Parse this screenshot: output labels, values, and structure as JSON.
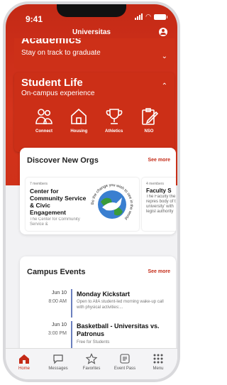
{
  "status": {
    "time": "9:41"
  },
  "header": {
    "title": "Universitas"
  },
  "academics": {
    "title": "Academics",
    "subtitle": "Stay on track to graduate"
  },
  "student_life": {
    "title": "Student Life",
    "subtitle": "On-campus experience",
    "items": [
      {
        "label": "Connect",
        "icon": "people-icon"
      },
      {
        "label": "Housing",
        "icon": "house-icon"
      },
      {
        "label": "Athletics",
        "icon": "trophy-icon"
      },
      {
        "label": "NSO",
        "icon": "clipboard-edit-icon"
      }
    ]
  },
  "orgs": {
    "title": "Discover New Orgs",
    "see_more": "See more",
    "items": [
      {
        "members": "7 members",
        "name": "Center for Community Service & Civic Engagement",
        "desc": "The Center for Community Service &"
      },
      {
        "members": "4 members",
        "name": "Faculty S",
        "desc": "The Faculty the repres body of th university' with legisl authority"
      }
    ],
    "logo_text": "Be the change you wish to see in the world"
  },
  "events": {
    "title": "Campus Events",
    "see_more": "See more",
    "items": [
      {
        "date": "Jun 10",
        "time": "8:00 AM",
        "name": "Monday Kickstart",
        "desc": "Open to AllA student-led morning wake-up call with physical activities:..."
      },
      {
        "date": "Jun 10",
        "time": "3:00 PM",
        "name": "Basketball - Universitas vs. Patronus",
        "desc": "Free for Students"
      }
    ]
  },
  "tabs": [
    {
      "label": "Home",
      "icon": "home-icon",
      "active": true
    },
    {
      "label": "Messages",
      "icon": "chat-icon"
    },
    {
      "label": "Favorites",
      "icon": "star-icon"
    },
    {
      "label": "Event Pass",
      "icon": "ticket-icon"
    },
    {
      "label": "Menu",
      "icon": "grid-icon"
    }
  ],
  "colors": {
    "brand": "#c42a16",
    "event_bar": "#6b7fbf"
  }
}
